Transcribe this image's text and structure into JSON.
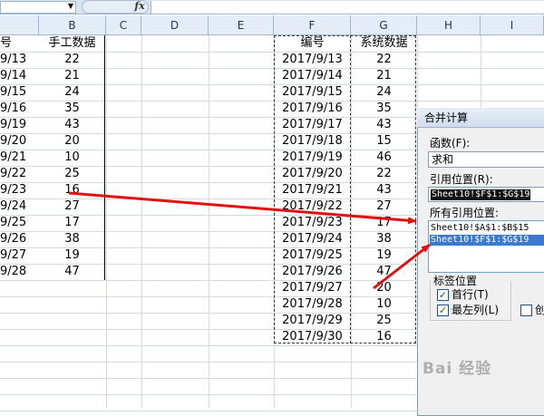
{
  "formula_bar": {
    "fx_label": "fx",
    "name_box_arrow": "▼"
  },
  "columns": [
    "B",
    "C",
    "D",
    "E",
    "F",
    "G",
    "H",
    "I"
  ],
  "left_table": {
    "header_a": "号",
    "header_b": "手工数据",
    "rows": [
      [
        "9/13",
        "22"
      ],
      [
        "9/14",
        "21"
      ],
      [
        "9/15",
        "24"
      ],
      [
        "9/16",
        "35"
      ],
      [
        "9/19",
        "43"
      ],
      [
        "9/20",
        "20"
      ],
      [
        "9/21",
        "10"
      ],
      [
        "9/22",
        "25"
      ],
      [
        "9/23",
        "16"
      ],
      [
        "9/24",
        "27"
      ],
      [
        "9/25",
        "17"
      ],
      [
        "9/26",
        "38"
      ],
      [
        "9/27",
        "19"
      ],
      [
        "9/28",
        "47"
      ]
    ]
  },
  "right_table": {
    "header_f": "编号",
    "header_g": "系统数据",
    "rows": [
      [
        "2017/9/13",
        "22"
      ],
      [
        "2017/9/14",
        "21"
      ],
      [
        "2017/9/15",
        "24"
      ],
      [
        "2017/9/16",
        "35"
      ],
      [
        "2017/9/17",
        "43"
      ],
      [
        "2017/9/18",
        "15"
      ],
      [
        "2017/9/19",
        "46"
      ],
      [
        "2017/9/20",
        "22"
      ],
      [
        "2017/9/21",
        "43"
      ],
      [
        "2017/9/22",
        "27"
      ],
      [
        "2017/9/23",
        "17"
      ],
      [
        "2017/9/24",
        "38"
      ],
      [
        "2017/9/25",
        "19"
      ],
      [
        "2017/9/26",
        "47"
      ],
      [
        "2017/9/27",
        "20"
      ],
      [
        "2017/9/28",
        "10"
      ],
      [
        "2017/9/29",
        "25"
      ],
      [
        "2017/9/30",
        "16"
      ]
    ]
  },
  "dialog": {
    "title": "合并计算",
    "function_label": "函数(F):",
    "function_value": "求和",
    "reference_label": "引用位置(R):",
    "reference_value": "Sheet10!$F$1:$G$19",
    "all_references_label": "所有引用位置:",
    "all_references": [
      "Sheet10!$A$1:$B$15",
      "Sheet10!$F$1:$G$19"
    ],
    "labels_group": "标签位置",
    "top_row_label": "首行(T)",
    "left_column_label": "最左列(L)",
    "create_links_label": "创",
    "check_mark": "✓"
  },
  "watermark": "Bai 经验",
  "colors": {
    "selection": "#3a78d4",
    "arrow": "#e01010"
  }
}
